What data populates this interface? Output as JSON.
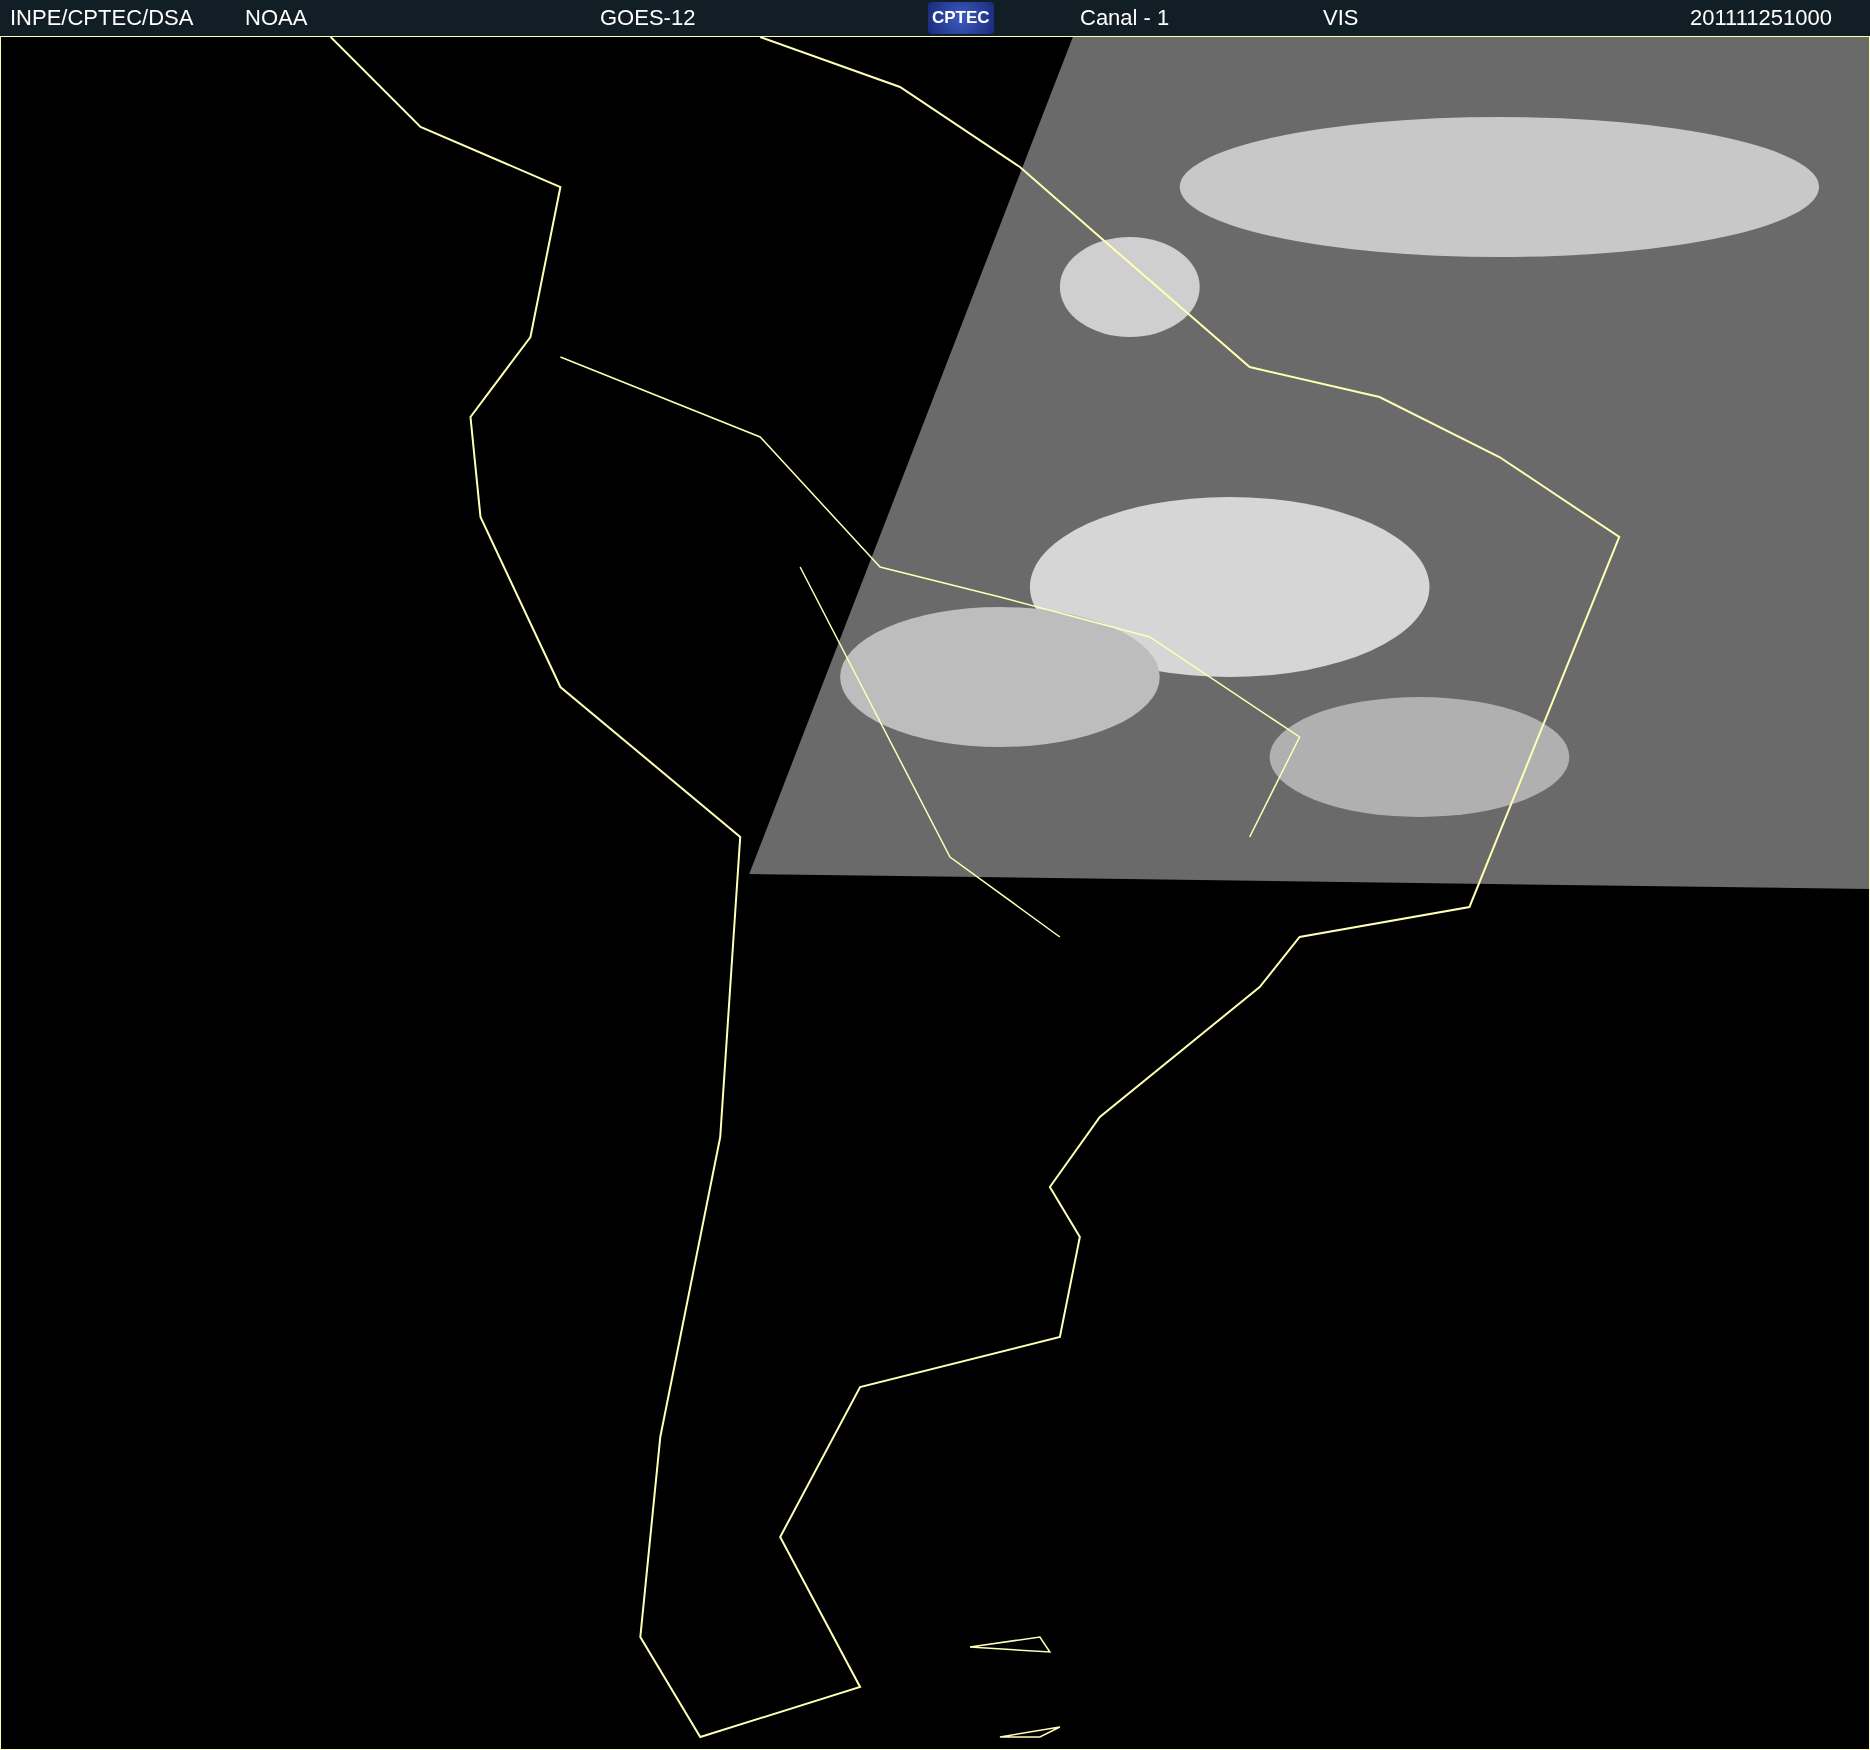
{
  "header": {
    "items": [
      {
        "kind": "text",
        "text": "INPE/CPTEC/DSA"
      },
      {
        "kind": "text",
        "text": "NOAA"
      },
      {
        "kind": "text",
        "text": "GOES-12"
      },
      {
        "kind": "logo",
        "text": "CPTEC"
      },
      {
        "kind": "text",
        "text": "Canal - 1"
      },
      {
        "kind": "text",
        "text": "VIS"
      },
      {
        "kind": "text",
        "text": "201111251000"
      }
    ]
  }
}
